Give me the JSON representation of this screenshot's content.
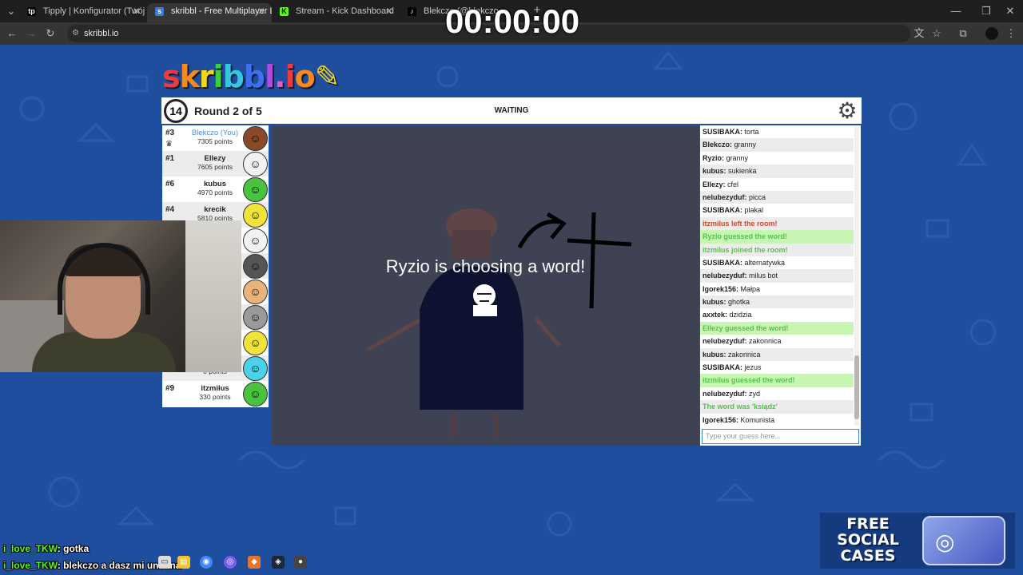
{
  "browser": {
    "tabs": [
      {
        "favicon": "tp",
        "label": "Tipply | Konfigurator (Twój cel)",
        "active": false
      },
      {
        "favicon": "s",
        "label": "skribbl - Free Multiplayer Draw",
        "active": true
      },
      {
        "favicon": "K",
        "label": "Stream - Kick Dashboard",
        "active": false
      },
      {
        "favicon": "♪",
        "label": "Blekczo (@blekczo...",
        "active": false
      }
    ],
    "new_tab": "+",
    "url": "skribbl.io"
  },
  "overlay_timer": "00:00:00",
  "logo": "skribbl.io",
  "game": {
    "timer_seconds": "14",
    "round_label": "Round 2 of 5",
    "status": "WAITING"
  },
  "players": [
    {
      "rank": "#3",
      "name": "Blekczo (You)",
      "points": "7305 points",
      "you": true,
      "crown": true,
      "avatar_color": "#8a4a2a"
    },
    {
      "rank": "#1",
      "name": "Ellezy",
      "points": "7605 points",
      "you": false,
      "crown": false,
      "avatar_color": "#f2f2f2"
    },
    {
      "rank": "#6",
      "name": "kubus",
      "points": "4970 points",
      "you": false,
      "crown": false,
      "avatar_color": "#4bc23d"
    },
    {
      "rank": "#4",
      "name": "krecik",
      "points": "5810 points",
      "you": false,
      "crown": false,
      "avatar_color": "#f2e33a"
    },
    {
      "rank": "",
      "name": "",
      "points": "",
      "you": false,
      "crown": false,
      "avatar_color": "#f2f2f2"
    },
    {
      "rank": "",
      "name": "",
      "points": "",
      "you": false,
      "crown": false,
      "avatar_color": "#555555"
    },
    {
      "rank": "",
      "name": "",
      "points": "",
      "you": false,
      "crown": false,
      "avatar_color": "#e8b47a"
    },
    {
      "rank": "",
      "name": "",
      "points": "",
      "you": false,
      "crown": false,
      "avatar_color": "#9a9a9a"
    },
    {
      "rank": "",
      "name": "",
      "points": "",
      "you": false,
      "crown": false,
      "avatar_color": "#f2e33a"
    },
    {
      "rank": "",
      "name": "",
      "points": "0 points",
      "you": false,
      "crown": false,
      "avatar_color": "#4ad3e8"
    },
    {
      "rank": "#9",
      "name": "itzmilus",
      "points": "330 points",
      "you": false,
      "crown": false,
      "avatar_color": "#4bc23d"
    }
  ],
  "canvas_message": "Ryzio is choosing a word!",
  "chat": [
    {
      "type": "msg",
      "user": "SUSIBAKA:",
      "text": "torta"
    },
    {
      "type": "msg",
      "user": "Blekczo:",
      "text": "granny"
    },
    {
      "type": "msg",
      "user": "Ryzio:",
      "text": "granny"
    },
    {
      "type": "msg",
      "user": "kubus:",
      "text": "sukienka"
    },
    {
      "type": "msg",
      "user": "Ellezy:",
      "text": "cfel"
    },
    {
      "type": "msg",
      "user": "nelubezyduf:",
      "text": "picca"
    },
    {
      "type": "msg",
      "user": "SUSIBAKA:",
      "text": "plakal"
    },
    {
      "type": "left",
      "user": "",
      "text": "itzmilus left the room!"
    },
    {
      "type": "guessed",
      "user": "",
      "text": "Ryzio guessed the word!"
    },
    {
      "type": "joined",
      "user": "",
      "text": "itzmilus joined the room!"
    },
    {
      "type": "msg",
      "user": "SUSIBAKA:",
      "text": "alternatywka"
    },
    {
      "type": "msg",
      "user": "nelubezyduf:",
      "text": "milus bot"
    },
    {
      "type": "msg",
      "user": "Igorek156:",
      "text": "Małpa"
    },
    {
      "type": "msg",
      "user": "kubus:",
      "text": "ghotka"
    },
    {
      "type": "msg",
      "user": "axxtek:",
      "text": "dzidzia"
    },
    {
      "type": "guessed",
      "user": "",
      "text": "Ellezy guessed the word!"
    },
    {
      "type": "msg",
      "user": "nelubezyduf:",
      "text": "zakonnica"
    },
    {
      "type": "msg",
      "user": "kubus:",
      "text": "zakonnica"
    },
    {
      "type": "msg",
      "user": "SUSIBAKA:",
      "text": "jezus"
    },
    {
      "type": "guessed",
      "user": "",
      "text": "itzmilus guessed the word!"
    },
    {
      "type": "msg",
      "user": "nelubezyduf:",
      "text": "zyd"
    },
    {
      "type": "joined",
      "user": "",
      "text": "The word was 'ksiądz'"
    },
    {
      "type": "msg",
      "user": "Igorek156:",
      "text": "Komunista"
    }
  ],
  "guess_placeholder": "Type your guess here...",
  "stream_chat": [
    {
      "user": "i_love_TKW",
      "text": ": gotka"
    },
    {
      "user": "i_love_TKW",
      "text": ": blekczo a dasz mi unbana"
    }
  ],
  "promo": {
    "line1": "FREE",
    "line2": "SOCIAL",
    "line3": "CASES"
  }
}
